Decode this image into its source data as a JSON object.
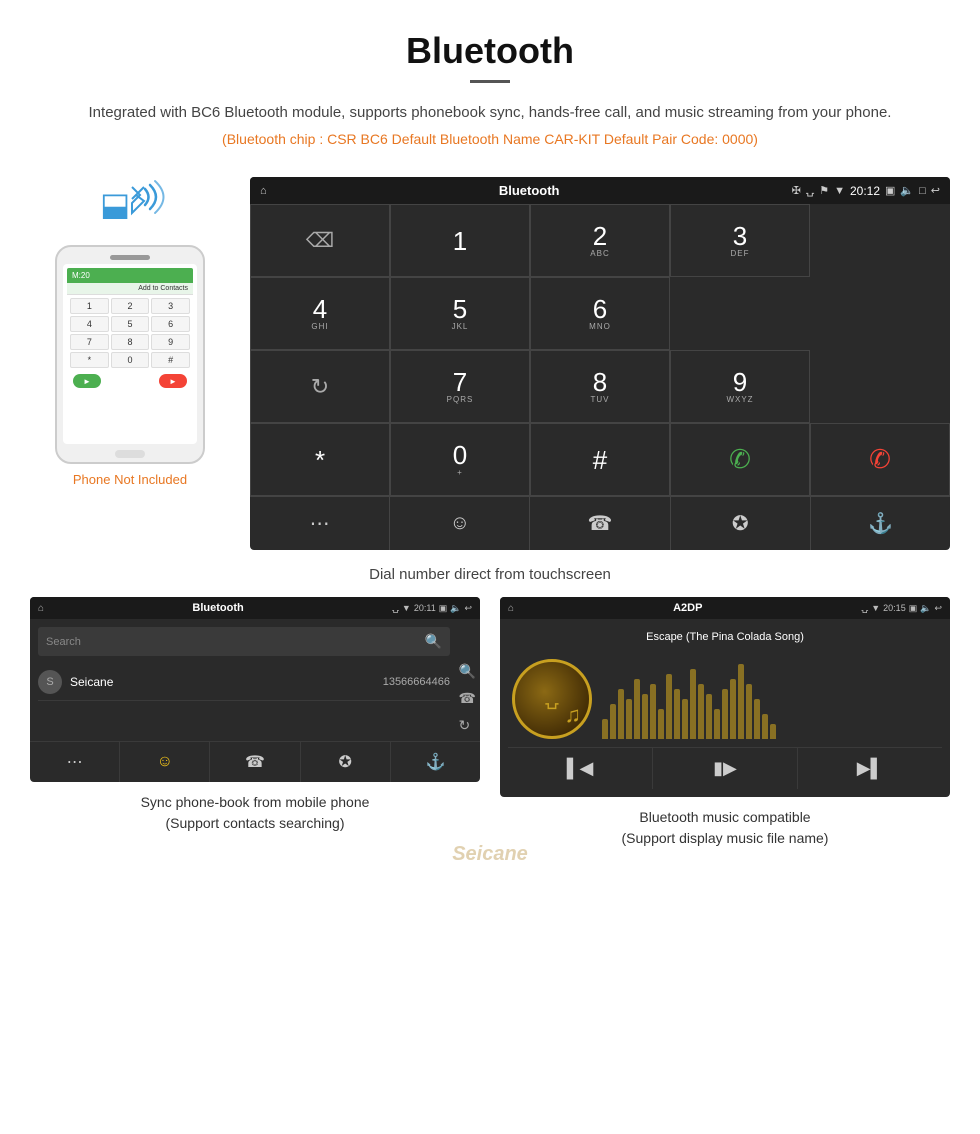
{
  "page": {
    "title": "Bluetooth",
    "description": "Integrated with BC6 Bluetooth module, supports phonebook sync, hands-free call, and music streaming from your phone.",
    "specs": "(Bluetooth chip : CSR BC6    Default Bluetooth Name CAR-KIT    Default Pair Code: 0000)"
  },
  "phone": {
    "not_included_label": "Phone Not Included",
    "screen_header": "M:20",
    "add_to_contacts": "Add to Contacts",
    "keys": [
      "1",
      "2",
      "3",
      "4",
      "5",
      "6",
      "7",
      "8",
      "9",
      "*",
      "0",
      "#"
    ]
  },
  "car_screen_dial": {
    "title": "Bluetooth",
    "time": "20:12",
    "keys": [
      {
        "num": "1",
        "sub": ""
      },
      {
        "num": "2",
        "sub": "ABC"
      },
      {
        "num": "3",
        "sub": "DEF"
      },
      {
        "num": "4",
        "sub": "GHI"
      },
      {
        "num": "5",
        "sub": "JKL"
      },
      {
        "num": "6",
        "sub": "MNO"
      },
      {
        "num": "7",
        "sub": "PQRS"
      },
      {
        "num": "8",
        "sub": "TUV"
      },
      {
        "num": "9",
        "sub": "WXYZ"
      },
      {
        "num": "*",
        "sub": ""
      },
      {
        "num": "0",
        "sub": "+"
      },
      {
        "num": "#",
        "sub": ""
      }
    ]
  },
  "dial_caption": "Dial number direct from touchscreen",
  "phonebook_screen": {
    "title": "Bluetooth",
    "time": "20:11",
    "search_placeholder": "Search",
    "contact": {
      "initial": "S",
      "name": "Seicane",
      "number": "13566664466"
    }
  },
  "phonebook_caption_line1": "Sync phone-book from mobile phone",
  "phonebook_caption_line2": "(Support contacts searching)",
  "music_screen": {
    "title": "A2DP",
    "time": "20:15",
    "song_title": "Escape (The Pina Colada Song)"
  },
  "music_caption_line1": "Bluetooth music compatible",
  "music_caption_line2": "(Support display music file name)",
  "watermark": "Seicane"
}
